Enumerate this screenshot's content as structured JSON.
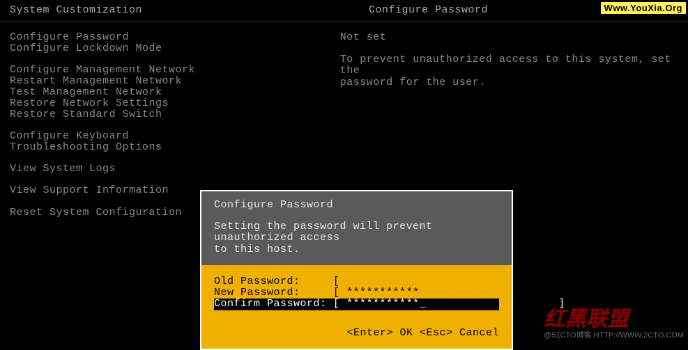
{
  "header": {
    "left_title": "System Customization",
    "right_title": "Configure Password"
  },
  "watermark": {
    "top": "Www.YouXia.Org",
    "bottom_script": "红黑联盟",
    "bottom_sub": "@51CTO博客\nHTTP://WWW.2CTO.COM"
  },
  "menu": {
    "groups": [
      [
        "Configure Password",
        "Configure Lockdown Mode"
      ],
      [
        "Configure Management Network",
        "Restart Management Network",
        "Test Management Network",
        "Restore Network Settings",
        "Restore Standard Switch"
      ],
      [
        "Configure Keyboard",
        "Troubleshooting Options"
      ],
      [
        "View System Logs"
      ],
      [
        "View Support Information"
      ],
      [
        "Reset System Configuration"
      ]
    ]
  },
  "info": {
    "status": "Not set",
    "desc1": "To prevent unauthorized access to this system, set the",
    "desc2": "password for the user."
  },
  "dialog": {
    "title": "Configure Password",
    "desc1": "Setting the password will prevent unauthorized access",
    "desc2": "to this host.",
    "fields": [
      {
        "label": "Old Password:    ",
        "value": "[                                 ]"
      },
      {
        "label": "New Password:    ",
        "value": "[ ***********                     ]"
      },
      {
        "label": "Confirm Password:",
        "value": "[ ***********_                    ]"
      }
    ],
    "footer": "<Enter> OK   <Esc> Cancel"
  }
}
